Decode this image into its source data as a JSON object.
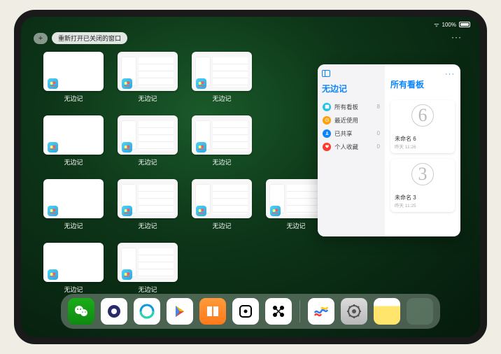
{
  "status": {
    "time": "",
    "wifi": "ᯤ",
    "battery": "100%"
  },
  "topbar": {
    "plus": "+",
    "reopen": "重新打开已关闭的窗口",
    "ellipsis": "···"
  },
  "thumbnails": [
    {
      "label": "无边记",
      "style": "blank"
    },
    {
      "label": "无边记",
      "style": "detailed"
    },
    {
      "label": "无边记",
      "style": "detailed"
    },
    {
      "label": "无边记",
      "style": "blank"
    },
    {
      "label": "无边记",
      "style": "detailed"
    },
    {
      "label": "无边记",
      "style": "detailed"
    },
    {
      "label": "无边记",
      "style": "blank"
    },
    {
      "label": "无边记",
      "style": "detailed"
    },
    {
      "label": "无边记",
      "style": "detailed"
    },
    {
      "label": "无边记",
      "style": "blank"
    },
    {
      "label": "无边记",
      "style": "detailed"
    },
    {
      "label": "无边记",
      "style": "detailed"
    }
  ],
  "panel": {
    "title": "无边记",
    "right_title": "所有看板",
    "ellipsis": "···",
    "categories": [
      {
        "label": "所有看板",
        "count": "8",
        "color": "#22c3e6"
      },
      {
        "label": "最近使用",
        "count": "",
        "color": "#ff9f0a"
      },
      {
        "label": "已共享",
        "count": "0",
        "color": "#0a84ff"
      },
      {
        "label": "个人收藏",
        "count": "0",
        "color": "#ff3b30"
      }
    ],
    "boards": [
      {
        "title": "未命名 6",
        "sub": "昨天 11:26",
        "doodle": "6"
      },
      {
        "title": "未命名 3",
        "sub": "昨天 11:25",
        "doodle": "3"
      }
    ]
  },
  "dock": {
    "items": [
      {
        "name": "wechat"
      },
      {
        "name": "quark"
      },
      {
        "name": "qqbrowser"
      },
      {
        "name": "play"
      },
      {
        "name": "books"
      },
      {
        "name": "app6"
      },
      {
        "name": "app7"
      }
    ],
    "recent": [
      {
        "name": "freeform"
      },
      {
        "name": "settings"
      },
      {
        "name": "notes"
      },
      {
        "name": "app-library"
      }
    ]
  }
}
